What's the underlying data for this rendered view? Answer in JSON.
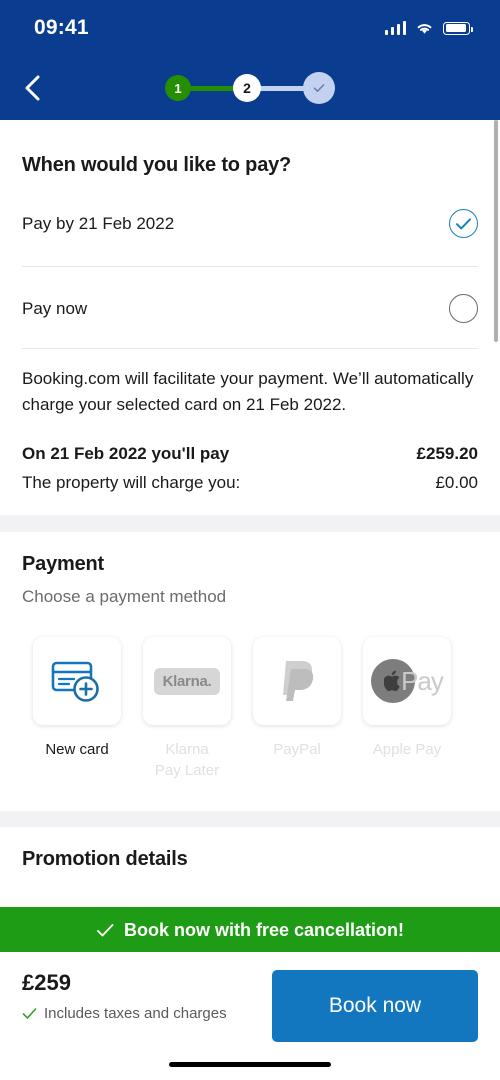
{
  "statusbar": {
    "time": "09:41",
    "signal_icon": "signal-bars-icon",
    "wifi_icon": "wifi-icon",
    "battery_icon": "battery-icon"
  },
  "header": {
    "back_icon": "chevron-left-icon",
    "background_color": "#0a3d8f",
    "stepper": {
      "steps": [
        {
          "label": "1",
          "state": "completed",
          "color": "#268e02"
        },
        {
          "label": "2",
          "state": "current",
          "color": "#ffffff"
        },
        {
          "label": "✓",
          "state": "upcoming",
          "color": "#c3d2ef"
        }
      ]
    }
  },
  "payment_timing": {
    "heading": "When would you like to pay?",
    "options": [
      {
        "label": "Pay by 21 Feb 2022",
        "selected": true
      },
      {
        "label": "Pay now",
        "selected": false
      }
    ],
    "description": "Booking.com will facilitate your payment. We’ll automatically charge your selected card on 21 Feb 2022.",
    "summary": [
      {
        "key": "On 21 Feb 2022 you'll pay",
        "value": "£259.20",
        "bold": true
      },
      {
        "key": "The property will charge you:",
        "value": "£0.00",
        "bold": false
      }
    ]
  },
  "payment": {
    "heading": "Payment",
    "subheading": "Choose a payment method",
    "methods": [
      {
        "label": "New card",
        "icon": "credit-card-plus-icon",
        "enabled": true
      },
      {
        "label": "Klarna\nPay Later",
        "icon": "klarna-icon",
        "enabled": false,
        "badge_text": "Klarna."
      },
      {
        "label": "PayPal",
        "icon": "paypal-icon",
        "enabled": false
      },
      {
        "label": "Apple Pay",
        "icon": "apple-pay-icon",
        "enabled": false,
        "badge_text": "Pay"
      }
    ]
  },
  "promotion": {
    "heading": "Promotion details"
  },
  "banner": {
    "text": "Book now with free cancellation!",
    "icon": "check-icon",
    "background_color": "#1f9c16"
  },
  "footer": {
    "price": "£259",
    "taxes_note": "Includes taxes and charges",
    "taxes_icon": "check-icon",
    "cta_label": "Book now",
    "cta_color": "#1277bf"
  }
}
